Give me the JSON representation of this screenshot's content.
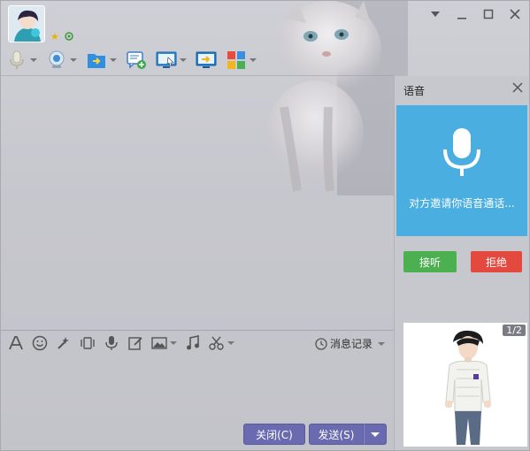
{
  "window": {
    "controls": [
      "chevron-down",
      "minimize",
      "maximize",
      "close"
    ]
  },
  "toolbar": {
    "items": [
      {
        "icon": "microphone-icon",
        "has_caret": true
      },
      {
        "icon": "camera-icon",
        "has_caret": true
      },
      {
        "icon": "send-file-icon",
        "has_caret": true
      },
      {
        "icon": "new-chat-icon",
        "has_caret": false
      },
      {
        "icon": "remote-assist-icon",
        "has_caret": true
      },
      {
        "icon": "share-screen-icon",
        "has_caret": false
      },
      {
        "icon": "apps-icon",
        "has_caret": true
      }
    ]
  },
  "input_toolbar": {
    "icons": [
      "font-icon",
      "emoji-icon",
      "magic-icon",
      "vibrate-icon",
      "voice-message-icon",
      "edit-icon",
      "image-icon",
      "music-icon",
      "screenshot-icon"
    ],
    "history_label": "消息记录"
  },
  "buttons": {
    "close_label": "关闭(C)",
    "send_label": "发送(S)"
  },
  "side_panel": {
    "title": "语音",
    "invite_text": "对方邀请你语音通话...",
    "accept_label": "接听",
    "reject_label": "拒绝",
    "show_page": "1/2"
  },
  "colors": {
    "voice_box": "#4aaee0",
    "accept": "#4caf50",
    "reject": "#e4493f",
    "button": "#6a6ab0"
  }
}
